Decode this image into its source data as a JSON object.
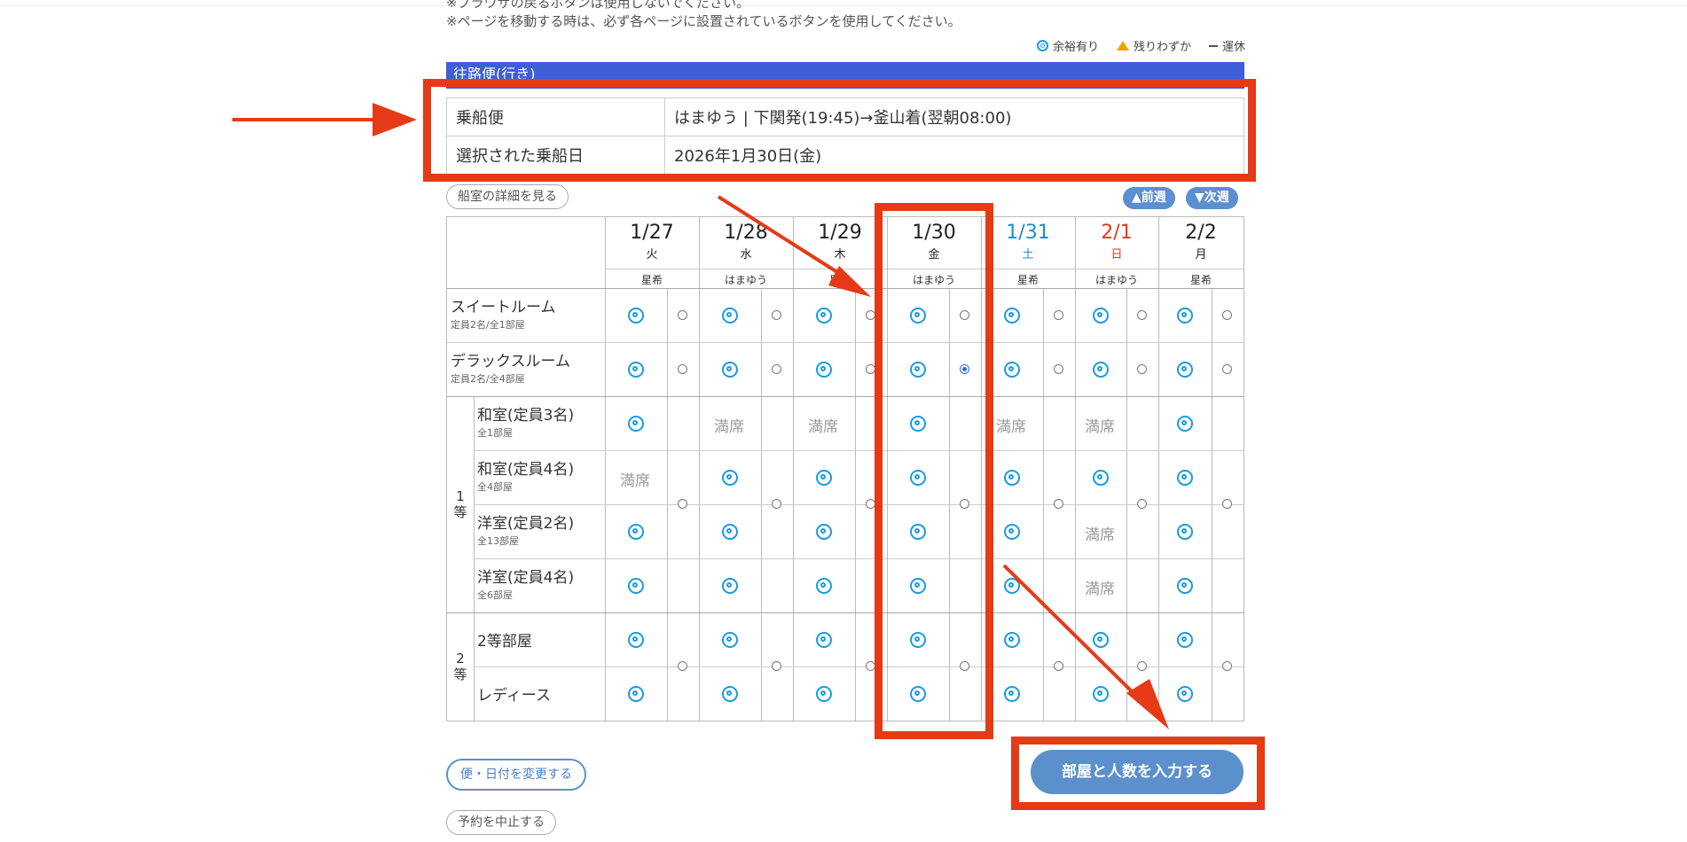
{
  "notices": [
    "※ブラウザの戻るボタンは使用しないでください。",
    "※ページを移動する時は、必ず各ページに設置されているボタンを使用してください。"
  ],
  "legend": {
    "available": "余裕有り",
    "few": "残りわずか",
    "suspended": "運休"
  },
  "section_title": "往路便(行き)",
  "info": {
    "ship_label": "乗船便",
    "ship_value": "はまゆう | 下関発(19:45)→釜山着(翌朝08:00)",
    "date_label": "選択された乗船日",
    "date_value": "2026年1月30日(金)"
  },
  "room_detail_button": "船室の詳細を見る",
  "prev_week": "▲前週",
  "next_week": "▼次週",
  "full_text": "満席",
  "days": [
    {
      "date": "1/27",
      "weekday": "火",
      "ship": "星希",
      "color": "#222222"
    },
    {
      "date": "1/28",
      "weekday": "水",
      "ship": "はまゆう",
      "color": "#222222"
    },
    {
      "date": "1/29",
      "weekday": "木",
      "ship": "星希",
      "color": "#222222"
    },
    {
      "date": "1/30",
      "weekday": "金",
      "ship": "はまゆう",
      "color": "#222222"
    },
    {
      "date": "1/31",
      "weekday": "土",
      "ship": "星希",
      "color": "#1a8fc8"
    },
    {
      "date": "2/1",
      "weekday": "日",
      "ship": "はまゆう",
      "color": "#e03a1e"
    },
    {
      "date": "2/2",
      "weekday": "月",
      "ship": "星希",
      "color": "#222222"
    }
  ],
  "group_labels": {
    "first": "1等",
    "second": "2等"
  },
  "rooms": [
    {
      "name": "スイートルーム",
      "sub": "定員2名/全1部屋",
      "status": [
        "A",
        "A",
        "A",
        "A",
        "A",
        "A",
        "A"
      ]
    },
    {
      "name": "デラックスルーム",
      "sub": "定員2名/全4部屋",
      "status": [
        "A",
        "A",
        "A",
        "A",
        "A",
        "A",
        "A"
      ]
    },
    {
      "name": "和室(定員3名)",
      "sub": "全1部屋",
      "status": [
        "A",
        "F",
        "F",
        "A",
        "F",
        "F",
        "A"
      ]
    },
    {
      "name": "和室(定員4名)",
      "sub": "全4部屋",
      "status": [
        "F",
        "A",
        "A",
        "A",
        "A",
        "A",
        "A"
      ]
    },
    {
      "name": "洋室(定員2名)",
      "sub": "全13部屋",
      "status": [
        "A",
        "A",
        "A",
        "A",
        "A",
        "F",
        "A"
      ]
    },
    {
      "name": "洋室(定員4名)",
      "sub": "全6部屋",
      "status": [
        "A",
        "A",
        "A",
        "A",
        "A",
        "F",
        "A"
      ]
    },
    {
      "name": "2等部屋",
      "sub": "",
      "status": [
        "A",
        "A",
        "A",
        "A",
        "A",
        "A",
        "A"
      ]
    },
    {
      "name": "レディース",
      "sub": "",
      "status": [
        "A",
        "A",
        "A",
        "A",
        "A",
        "A",
        "A"
      ]
    }
  ],
  "selected": {
    "row": "デラックスルーム",
    "day": "1/30"
  },
  "buttons": {
    "submit": "部屋と人数を入力する",
    "change": "便・日付を変更する",
    "cancel": "予約を中止する"
  }
}
